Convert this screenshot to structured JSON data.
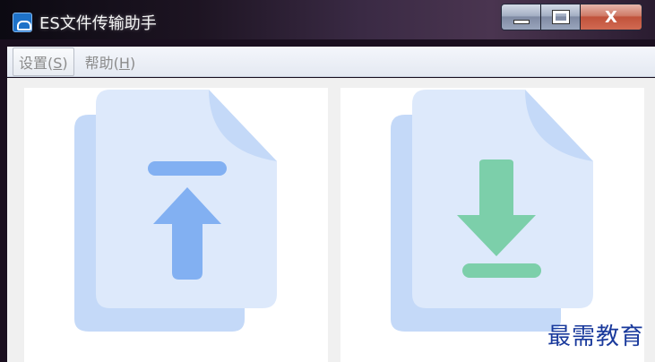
{
  "window": {
    "title": "ES文件传输助手",
    "minimize_label": "–",
    "close_label": "X"
  },
  "menu": {
    "settings": {
      "label": "设置(",
      "mnemonic": "S",
      "end": ")"
    },
    "help": {
      "label": "帮助(",
      "mnemonic": "H",
      "end": ")"
    }
  },
  "cards": {
    "upload": {
      "icon": "file-upload-icon",
      "label": ""
    },
    "download": {
      "icon": "file-download-icon",
      "label": ""
    }
  },
  "watermark": "最需教育",
  "colors": {
    "upload_accent": "#82b0f2",
    "download_accent": "#7ccfaa",
    "file_back": "#c4d9f8",
    "file_front": "#dde9fb"
  }
}
